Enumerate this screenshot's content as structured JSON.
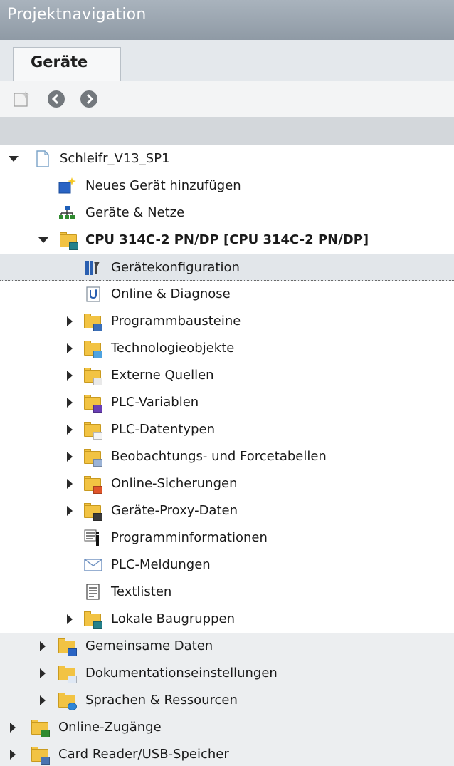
{
  "window": {
    "title": "Projektnavigation"
  },
  "tabs": [
    {
      "label": "Geräte"
    }
  ],
  "toolbar": {
    "buttons": [
      {
        "icon": "new-item-icon"
      },
      {
        "icon": "back-arrow-icon"
      },
      {
        "icon": "forward-arrow-icon"
      }
    ]
  },
  "tree": [
    {
      "label": "Schleifr_V13_SP1",
      "icon": "project-icon",
      "state": "expanded",
      "bold": false
    },
    {
      "label": "Neues Gerät hinzufügen",
      "icon": "add-device-icon",
      "state": "none",
      "bold": false
    },
    {
      "label": "Geräte & Netze",
      "icon": "network-icon",
      "state": "none",
      "bold": false
    },
    {
      "label": "CPU 314C-2 PN/DP [CPU 314C-2 PN/DP]",
      "icon": "cpu-folder-icon",
      "state": "expanded",
      "bold": true
    },
    {
      "label": "Gerätekonfiguration",
      "icon": "device-config-icon",
      "state": "none",
      "selected": true,
      "bold": false
    },
    {
      "label": "Online & Diagnose",
      "icon": "online-diagnostics-icon",
      "state": "none",
      "bold": false
    },
    {
      "label": "Programmbausteine",
      "icon": "program-blocks-folder-icon",
      "state": "collapsed",
      "bold": false
    },
    {
      "label": "Technologieobjekte",
      "icon": "technology-objects-folder-icon",
      "state": "collapsed",
      "bold": false
    },
    {
      "label": "Externe Quellen",
      "icon": "external-sources-folder-icon",
      "state": "collapsed",
      "bold": false
    },
    {
      "label": "PLC-Variablen",
      "icon": "plc-tags-folder-icon",
      "state": "collapsed",
      "bold": false
    },
    {
      "label": "PLC-Datentypen",
      "icon": "plc-datatypes-folder-icon",
      "state": "collapsed",
      "bold": false
    },
    {
      "label": "Beobachtungs- und Forcetabellen",
      "icon": "watch-tables-folder-icon",
      "state": "collapsed",
      "bold": false
    },
    {
      "label": "Online-Sicherungen",
      "icon": "online-backups-folder-icon",
      "state": "collapsed",
      "bold": false
    },
    {
      "label": "Geräte-Proxy-Daten",
      "icon": "device-proxy-folder-icon",
      "state": "collapsed",
      "bold": false
    },
    {
      "label": "Programminformationen",
      "icon": "program-info-icon",
      "state": "none",
      "bold": false
    },
    {
      "label": "PLC-Meldungen",
      "icon": "plc-messages-icon",
      "state": "none",
      "bold": false
    },
    {
      "label": "Textlisten",
      "icon": "text-lists-icon",
      "state": "none",
      "bold": false
    },
    {
      "label": "Lokale Baugruppen",
      "icon": "local-modules-folder-icon",
      "state": "collapsed",
      "bold": false
    },
    {
      "label": "Gemeinsame Daten",
      "icon": "common-data-folder-icon",
      "state": "collapsed",
      "shaded": true,
      "bold": false
    },
    {
      "label": "Dokumentationseinstellungen",
      "icon": "documentation-settings-folder-icon",
      "state": "collapsed",
      "shaded": true,
      "bold": false
    },
    {
      "label": "Sprachen & Ressourcen",
      "icon": "languages-resources-folder-icon",
      "state": "collapsed",
      "shaded": true,
      "bold": false
    },
    {
      "label": "Online-Zugänge",
      "icon": "online-access-folder-icon",
      "state": "collapsed",
      "shaded": true,
      "bold": false
    },
    {
      "label": "Card Reader/USB-Speicher",
      "icon": "card-reader-folder-icon",
      "state": "collapsed",
      "shaded": true,
      "bold": false
    }
  ],
  "colors": {
    "titlebar": "#97a2ad",
    "accent": "#f2c343"
  }
}
